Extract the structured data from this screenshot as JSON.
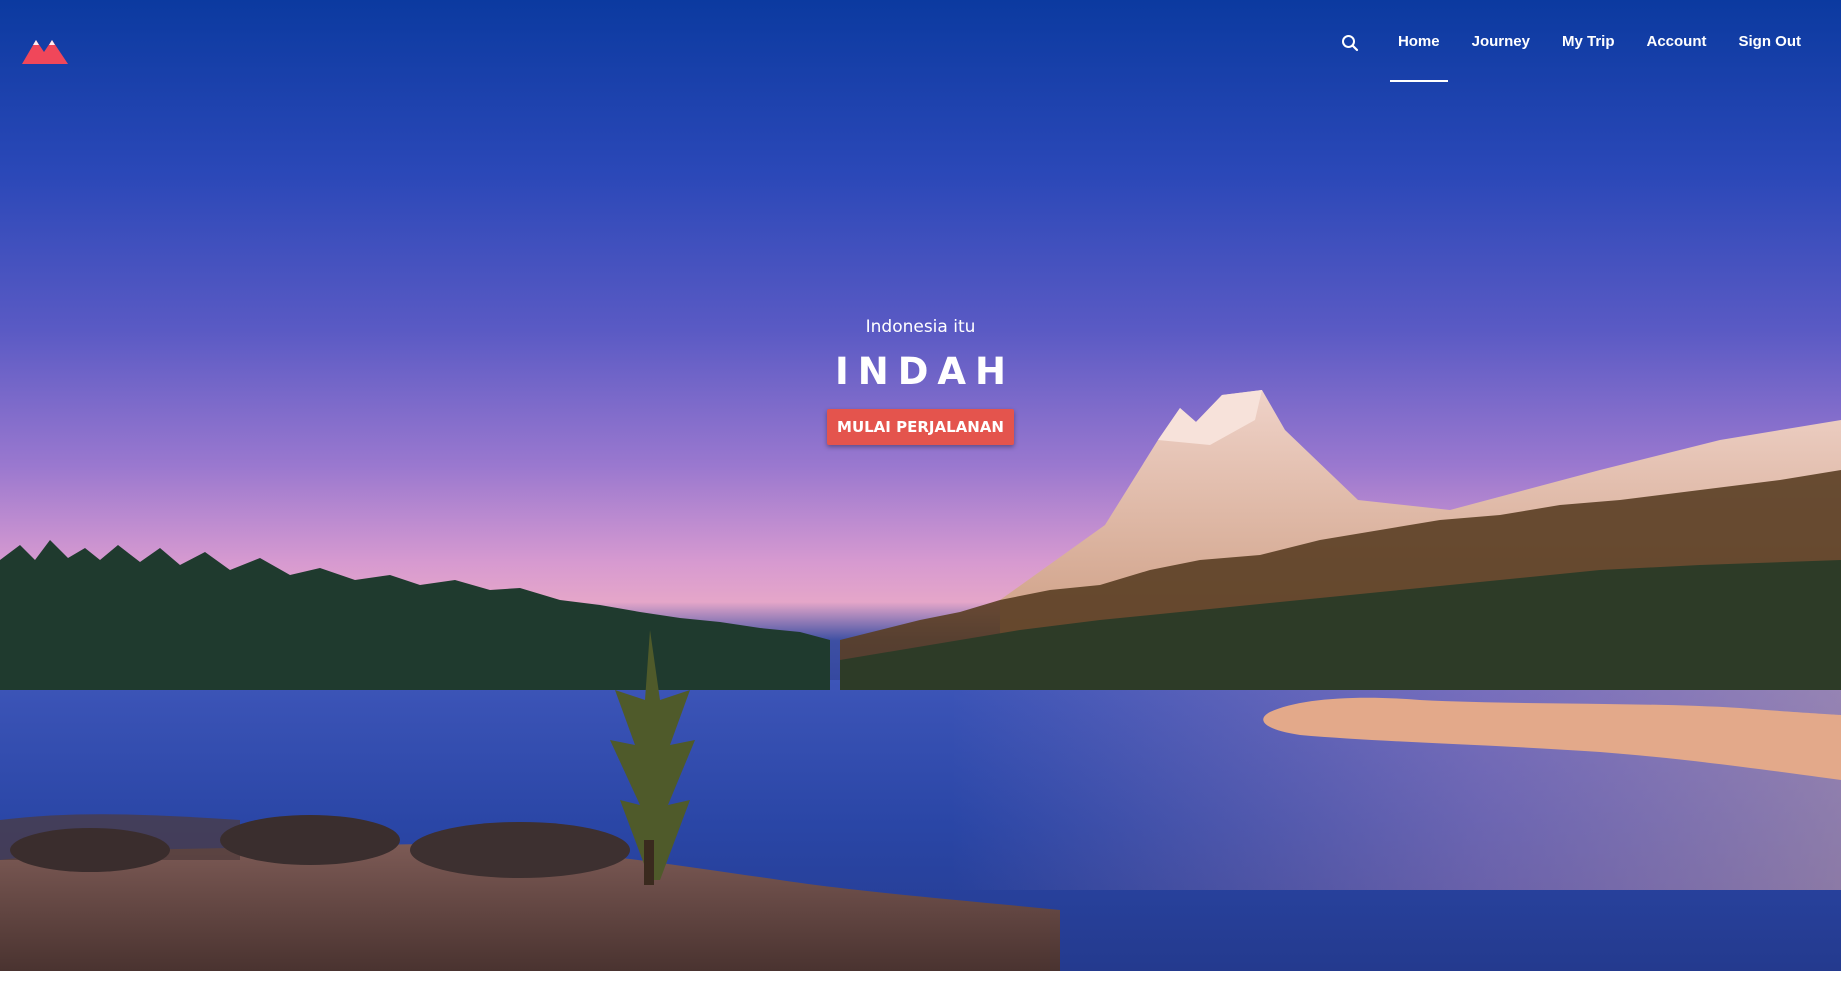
{
  "brand": {
    "logo_icon": "mountain-icon",
    "accent_color": "#f0475a"
  },
  "nav": {
    "search_icon": "search-icon",
    "items": [
      {
        "label": "Home",
        "active": true
      },
      {
        "label": "Journey",
        "active": false
      },
      {
        "label": "My Trip",
        "active": false
      },
      {
        "label": "Account",
        "active": false
      },
      {
        "label": "Sign Out",
        "active": false
      }
    ]
  },
  "hero": {
    "eyebrow": "Indonesia itu",
    "headline": "INDAH",
    "cta_label": "MULAI PERJALANAN",
    "cta_color": "#e4544d",
    "background_image": "mountain-lake-landscape"
  }
}
